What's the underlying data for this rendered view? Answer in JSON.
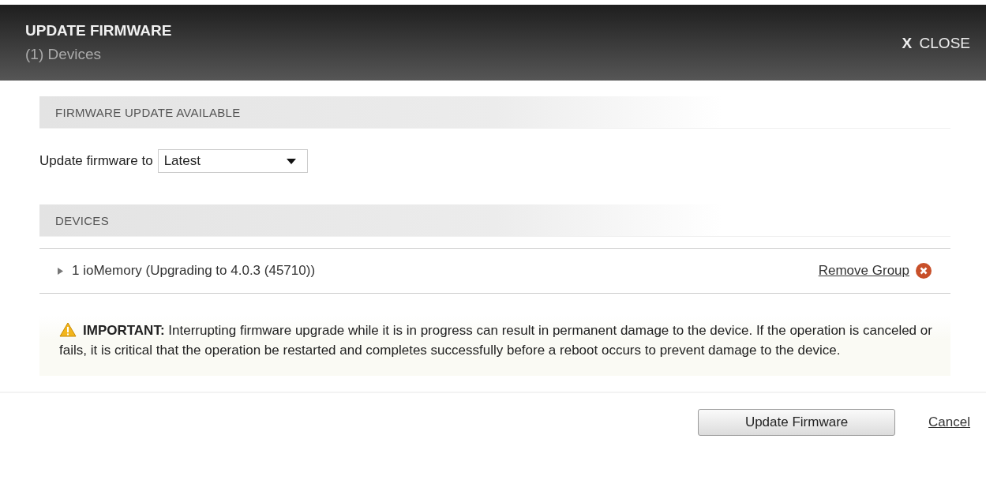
{
  "header": {
    "title": "UPDATE FIRMWARE",
    "subtitle": "(1) Devices",
    "close_icon": "X",
    "close_label": "CLOSE"
  },
  "firmware_section": {
    "heading": "FIRMWARE UPDATE AVAILABLE",
    "field_label": "Update firmware to",
    "select_value": "Latest"
  },
  "devices_section": {
    "heading": "DEVICES",
    "groups": [
      {
        "label": "1 ioMemory (Upgrading to 4.0.3 (45710))",
        "expanded": false,
        "action": "Remove Group"
      }
    ]
  },
  "warning": {
    "text": "**IMPORTANT:** Interrupting firmware upgrade while it is in progress can result in permanent damage to the device. If the operation is canceled or fails, it is critical that the operation be restarted and completes successfully before a reboot occurs to prevent damage to the device."
  },
  "buttons": {
    "primary": "Update Firmware",
    "cancel": "Cancel"
  }
}
